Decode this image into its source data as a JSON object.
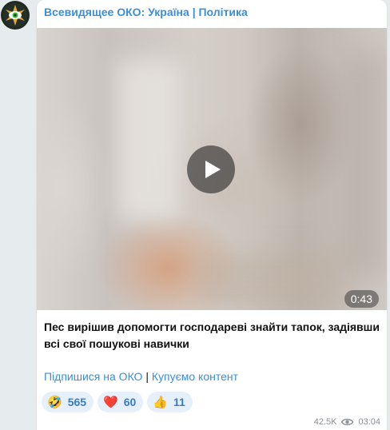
{
  "channel": {
    "name": "Всевидящее ОКО: Україна | Політика"
  },
  "video": {
    "duration": "0:43"
  },
  "post": {
    "caption": "Пес вирішив допомогти господареві знайти тапок, задіявши всі свої пошукові навички",
    "link_subscribe": "Підпишися на ОКО",
    "separator": " | ",
    "link_buy": "Купуємо контент"
  },
  "reactions": [
    {
      "emoji": "🤣",
      "count": "565"
    },
    {
      "emoji": "❤️",
      "count": "60"
    },
    {
      "emoji": "👍",
      "count": "11"
    }
  ],
  "meta": {
    "views": "42.5K",
    "time": "03:04"
  },
  "colors": {
    "accent": "#3a8fd6",
    "reaction_bg": "#e6f0fa",
    "background": "#e6ebee"
  }
}
